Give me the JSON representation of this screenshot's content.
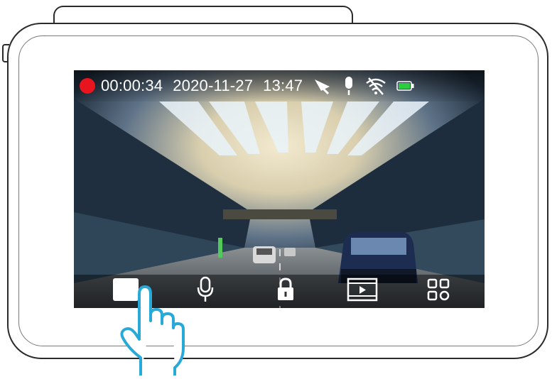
{
  "status": {
    "rec_time": "00:00:34",
    "date": "2020-11-27",
    "time": "13:47",
    "rec_color": "#e8141e",
    "battery_color": "#2ecc40",
    "icons": [
      "recording-dot-icon",
      "satellite-gps-icon",
      "microphone-icon",
      "wifi-off-icon",
      "battery-icon"
    ]
  },
  "toolbar": {
    "icons": [
      "record-button-icon",
      "microphone-icon",
      "lock-icon",
      "playback-icon",
      "menu-grid-icon"
    ]
  },
  "hand_color": "#29a9d8"
}
